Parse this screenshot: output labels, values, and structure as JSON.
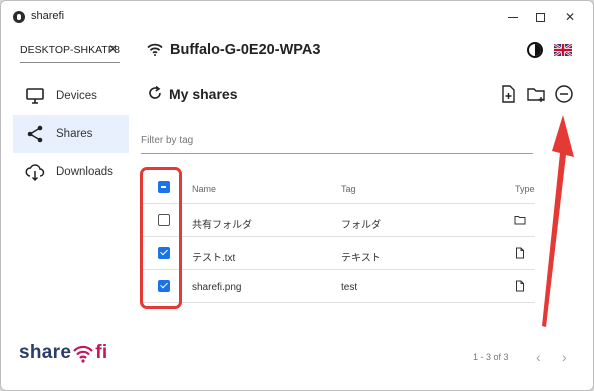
{
  "window": {
    "title": "sharefi"
  },
  "header": {
    "device_chip": "DESKTOP-SHKATF8",
    "network_name": "Buffalo-G-0E20-WPA3"
  },
  "sidebar": {
    "items": [
      {
        "label": "Devices",
        "icon": "monitor-icon",
        "active": false
      },
      {
        "label": "Shares",
        "icon": "share-icon",
        "active": true
      },
      {
        "label": "Downloads",
        "icon": "cloud-download-icon",
        "active": false
      }
    ]
  },
  "main": {
    "title": "My shares",
    "filter_placeholder": "Filter by tag",
    "columns": {
      "name": "Name",
      "tag": "Tag",
      "type": "Type"
    },
    "rows": [
      {
        "name": "共有フォルダ",
        "tag": "フォルダ",
        "type": "folder-icon",
        "checked": false
      },
      {
        "name": "テスト.txt",
        "tag": "テキスト",
        "type": "file-icon",
        "checked": true
      },
      {
        "name": "sharefi.png",
        "tag": "test",
        "type": "file-icon",
        "checked": true
      }
    ],
    "pagination": "1 - 3 of 3"
  },
  "logo": {
    "text_left": "share",
    "text_right": "fi"
  },
  "colors": {
    "accent": "#1a73e8",
    "highlight": "#e53935",
    "sidebar_active": "#e8f0fe",
    "logo_primary": "#2a3e6a",
    "logo_secondary": "#c2185b"
  }
}
